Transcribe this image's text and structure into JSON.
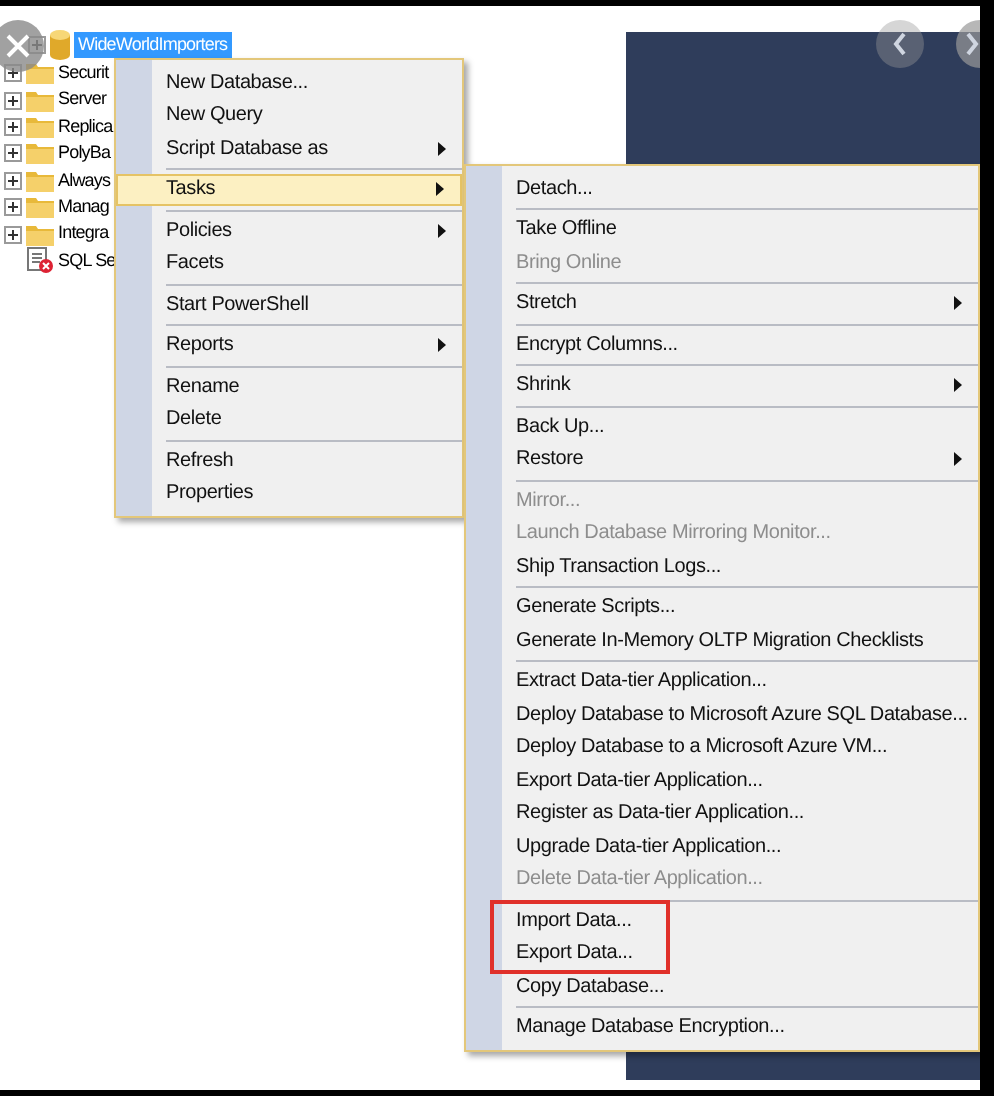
{
  "tree": {
    "root": {
      "label": "WideWorldImporters",
      "selected": true
    },
    "items": [
      {
        "label": "Securit",
        "kind": "folder"
      },
      {
        "label": "Server",
        "kind": "folder"
      },
      {
        "label": "Replica",
        "kind": "folder"
      },
      {
        "label": "PolyBa",
        "kind": "folder"
      },
      {
        "label": "Always",
        "kind": "folder"
      },
      {
        "label": "Manag",
        "kind": "folder"
      },
      {
        "label": "Integra",
        "kind": "folder"
      },
      {
        "label": "SQL Se",
        "kind": "agent"
      }
    ]
  },
  "context_menu": [
    {
      "kind": "item",
      "label": "New Database...",
      "selected": false,
      "submenu": false
    },
    {
      "kind": "item",
      "label": "New Query",
      "selected": false,
      "submenu": false
    },
    {
      "kind": "item",
      "label": "Script Database as",
      "selected": false,
      "submenu": true
    },
    {
      "kind": "separator"
    },
    {
      "kind": "item",
      "label": "Tasks",
      "selected": true,
      "submenu": true
    },
    {
      "kind": "separator"
    },
    {
      "kind": "item",
      "label": "Policies",
      "selected": false,
      "submenu": true
    },
    {
      "kind": "item",
      "label": "Facets",
      "selected": false,
      "submenu": false
    },
    {
      "kind": "separator"
    },
    {
      "kind": "item",
      "label": "Start PowerShell",
      "selected": false,
      "submenu": false
    },
    {
      "kind": "separator"
    },
    {
      "kind": "item",
      "label": "Reports",
      "selected": false,
      "submenu": true
    },
    {
      "kind": "separator"
    },
    {
      "kind": "item",
      "label": "Rename",
      "selected": false,
      "submenu": false
    },
    {
      "kind": "item",
      "label": "Delete",
      "selected": false,
      "submenu": false
    },
    {
      "kind": "separator"
    },
    {
      "kind": "item",
      "label": "Refresh",
      "selected": false,
      "submenu": false
    },
    {
      "kind": "item",
      "label": "Properties",
      "selected": false,
      "submenu": false
    }
  ],
  "tasks_menu": [
    {
      "kind": "item",
      "label": "Detach...",
      "disabled": false,
      "submenu": false,
      "marked": false
    },
    {
      "kind": "separator"
    },
    {
      "kind": "item",
      "label": "Take Offline",
      "disabled": false,
      "submenu": false,
      "marked": false
    },
    {
      "kind": "item",
      "label": "Bring Online",
      "disabled": true,
      "submenu": false,
      "marked": false
    },
    {
      "kind": "separator"
    },
    {
      "kind": "item",
      "label": "Stretch",
      "disabled": false,
      "submenu": true,
      "marked": false
    },
    {
      "kind": "separator"
    },
    {
      "kind": "item",
      "label": "Encrypt Columns...",
      "disabled": false,
      "submenu": false,
      "marked": false
    },
    {
      "kind": "separator"
    },
    {
      "kind": "item",
      "label": "Shrink",
      "disabled": false,
      "submenu": true,
      "marked": false
    },
    {
      "kind": "separator"
    },
    {
      "kind": "item",
      "label": "Back Up...",
      "disabled": false,
      "submenu": false,
      "marked": false
    },
    {
      "kind": "item",
      "label": "Restore",
      "disabled": false,
      "submenu": true,
      "marked": false
    },
    {
      "kind": "separator"
    },
    {
      "kind": "item",
      "label": "Mirror...",
      "disabled": true,
      "submenu": false,
      "marked": false
    },
    {
      "kind": "item",
      "label": "Launch Database Mirroring Monitor...",
      "disabled": true,
      "submenu": false,
      "marked": false
    },
    {
      "kind": "item",
      "label": "Ship Transaction Logs...",
      "disabled": false,
      "submenu": false,
      "marked": false
    },
    {
      "kind": "separator"
    },
    {
      "kind": "item",
      "label": "Generate Scripts...",
      "disabled": false,
      "submenu": false,
      "marked": false
    },
    {
      "kind": "item",
      "label": "Generate In-Memory OLTP Migration Checklists",
      "disabled": false,
      "submenu": false,
      "marked": false
    },
    {
      "kind": "separator"
    },
    {
      "kind": "item",
      "label": "Extract Data-tier Application...",
      "disabled": false,
      "submenu": false,
      "marked": false
    },
    {
      "kind": "item",
      "label": "Deploy Database to Microsoft Azure SQL Database...",
      "disabled": false,
      "submenu": false,
      "marked": false
    },
    {
      "kind": "item",
      "label": "Deploy Database to a Microsoft Azure VM...",
      "disabled": false,
      "submenu": false,
      "marked": false
    },
    {
      "kind": "item",
      "label": "Export Data-tier Application...",
      "disabled": false,
      "submenu": false,
      "marked": false
    },
    {
      "kind": "item",
      "label": "Register as Data-tier Application...",
      "disabled": false,
      "submenu": false,
      "marked": false
    },
    {
      "kind": "item",
      "label": "Upgrade Data-tier Application...",
      "disabled": false,
      "submenu": false,
      "marked": false
    },
    {
      "kind": "item",
      "label": "Delete Data-tier Application...",
      "disabled": true,
      "submenu": false,
      "marked": false
    },
    {
      "kind": "separator"
    },
    {
      "kind": "item",
      "label": "Import Data...",
      "disabled": false,
      "submenu": false,
      "marked": true
    },
    {
      "kind": "item",
      "label": "Export Data...",
      "disabled": false,
      "submenu": false,
      "marked": true
    },
    {
      "kind": "item",
      "label": "Copy Database...",
      "disabled": false,
      "submenu": false,
      "marked": false
    },
    {
      "kind": "separator"
    },
    {
      "kind": "item",
      "label": "Manage Database Encryption...",
      "disabled": false,
      "submenu": false,
      "marked": false
    }
  ]
}
